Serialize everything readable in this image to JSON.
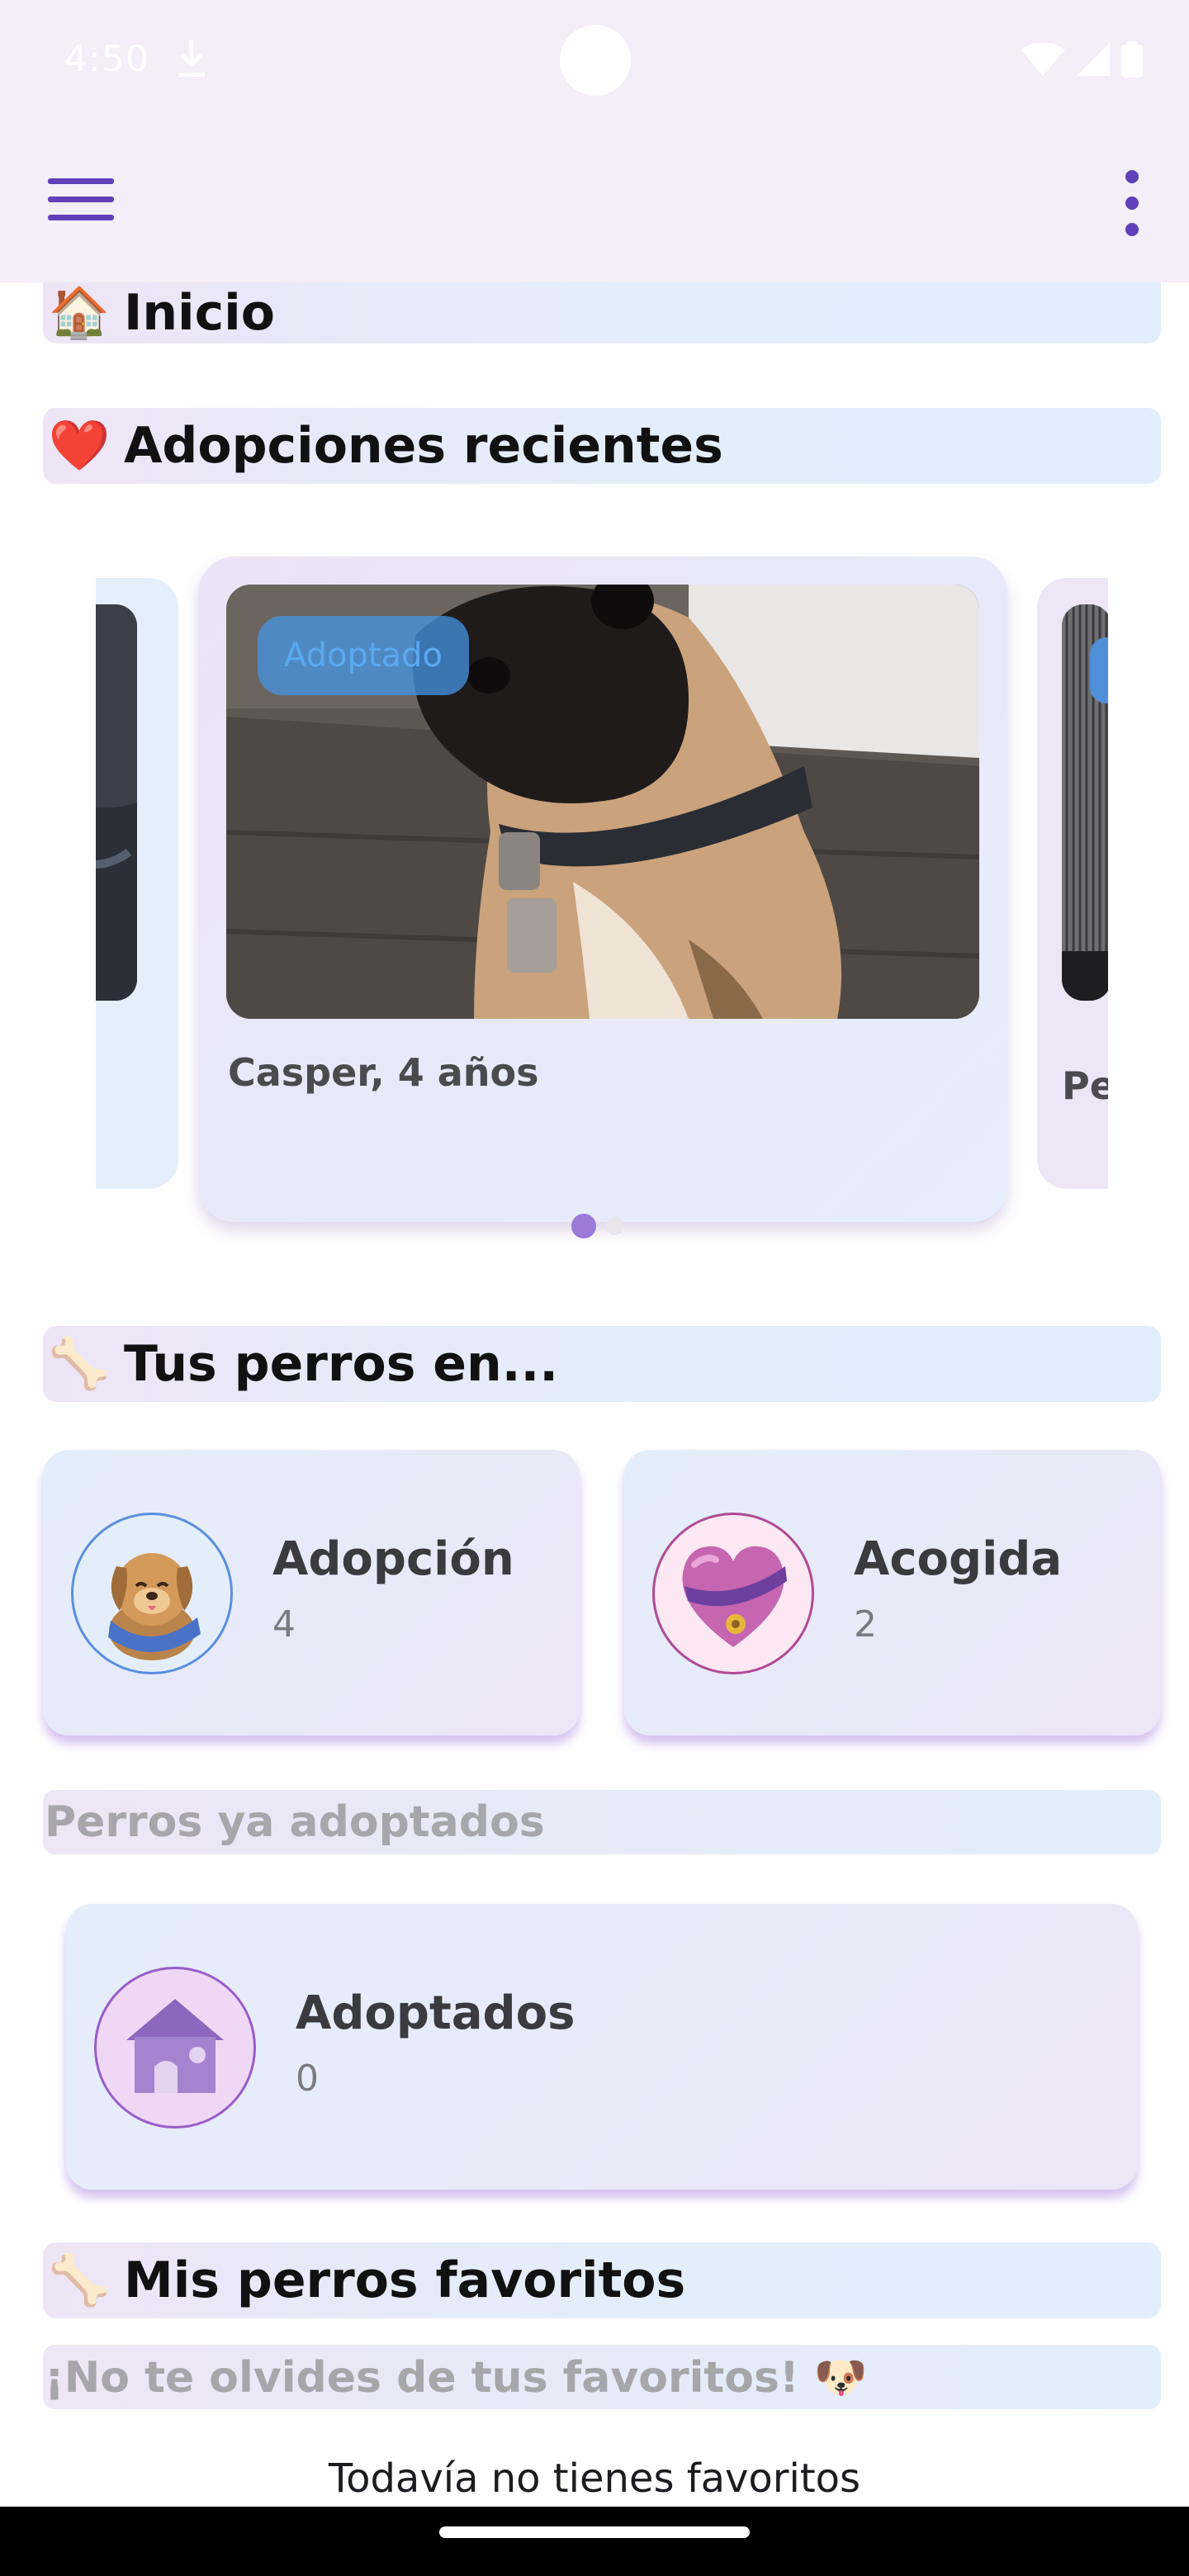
{
  "status_bar": {
    "time": "4:50"
  },
  "colors": {
    "accent": "#6040b8",
    "badge": "#4a96e6",
    "dot_active": "#9b7ad8"
  },
  "icons": {
    "menu": "hamburger-icon",
    "more": "kebab-icon",
    "download": "download-icon",
    "wifi": "wifi-icon",
    "signal": "signal-icon",
    "battery": "battery-icon"
  },
  "sections": {
    "home": {
      "emoji": "🏠",
      "title": "Inicio"
    },
    "recent": {
      "emoji": "❤️",
      "title": "Adopciones recientes"
    },
    "yours": {
      "emoji": "🦴",
      "title": "Tus perros en..."
    },
    "adopted_sub": {
      "text": "Perros ya adoptados"
    },
    "favorites": {
      "emoji": "🦴",
      "title": "Mis perros favoritos"
    },
    "favorites_sub": {
      "text": "¡No te olvides de tus favoritos! 🐶"
    }
  },
  "carousel": {
    "current": {
      "badge": "Adoptado",
      "caption": "Casper, 4 años"
    },
    "next_caption": "Pe",
    "pages": 2,
    "active_page": 0
  },
  "categories": [
    {
      "label": "Adopción",
      "count": "4"
    },
    {
      "label": "Acogida",
      "count": "2"
    },
    {
      "label": "Adoptados",
      "count": "0"
    }
  ],
  "favorites_empty": "Todavía no tienes favoritos"
}
